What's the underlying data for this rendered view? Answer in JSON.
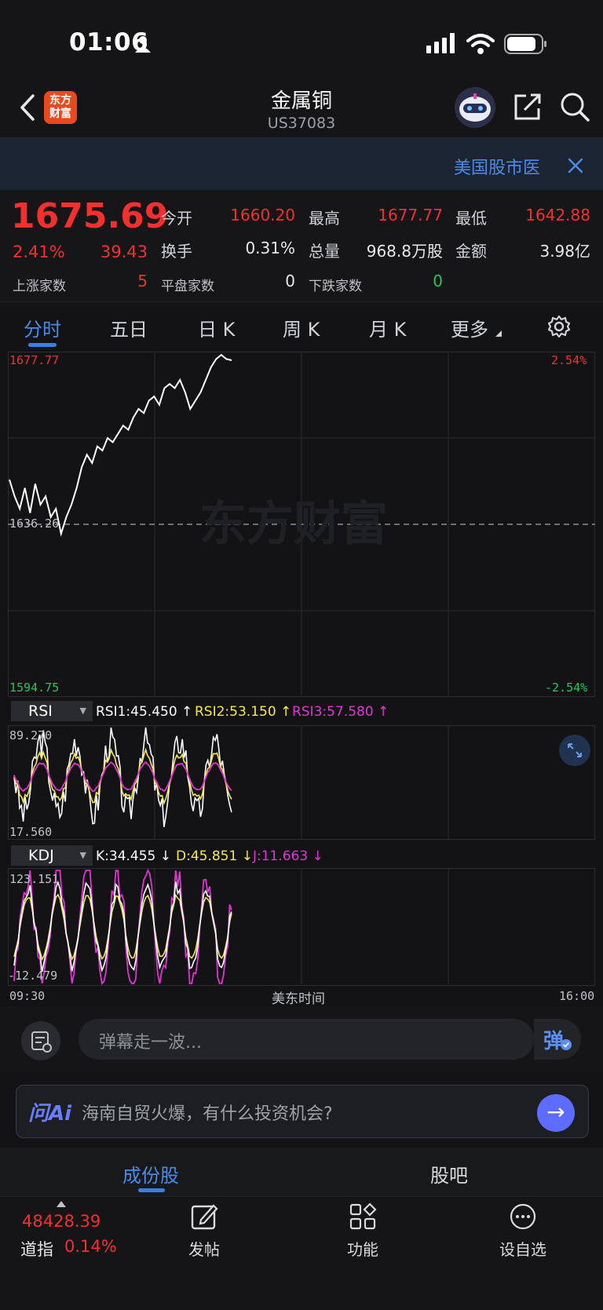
{
  "status": {
    "time": "01:06"
  },
  "header": {
    "title": "金属铜",
    "code": "US37083",
    "logo_line1": "东方",
    "logo_line2": "财富"
  },
  "banner": {
    "text": "美国股市医"
  },
  "quote": {
    "price": "1675.69",
    "change_pct": "2.41%",
    "change": "39.43",
    "open_label": "今开",
    "open": "1660.20",
    "high_label": "最高",
    "high": "1677.77",
    "low_label": "最低",
    "low": "1642.88",
    "turnover_label": "换手",
    "turnover": "0.31%",
    "volume_label": "总量",
    "volume": "968.8万股",
    "amount_label": "金额",
    "amount": "3.98亿",
    "up_label": "上涨家数",
    "up": "5",
    "flat_label": "平盘家数",
    "flat": "0",
    "down_label": "下跌家数",
    "down": "0"
  },
  "tabs": [
    {
      "label": "分时",
      "active": true
    },
    {
      "label": "五日"
    },
    {
      "label": "日 K"
    },
    {
      "label": "周 K"
    },
    {
      "label": "月 K"
    },
    {
      "label": "更多"
    }
  ],
  "chart": {
    "top_price": "1677.77",
    "mid_price": "1636.26",
    "bottom_price": "1594.75",
    "top_pct": "2.54%",
    "bottom_pct": "-2.54%",
    "watermark": "东方财富",
    "time_start": "09:30",
    "time_mid": "美东时间",
    "time_end": "16:00"
  },
  "rsi": {
    "name": "RSI",
    "rsi1": "RSI1:45.450 ↑",
    "rsi2": "RSI2:53.150 ↑",
    "rsi3": "RSI3:57.580 ↑",
    "max": "89.270",
    "min": "17.560"
  },
  "kdj": {
    "name": "KDJ",
    "k": "K:34.455 ↓",
    "d": "D:45.851 ↓",
    "j": "J:11.663 ↓",
    "max": "123.151",
    "min": "-12.479"
  },
  "chart_data": {
    "type": "line",
    "title": "",
    "x_range": [
      "09:30",
      "16:00"
    ],
    "ylim": [
      1594.75,
      1677.77
    ],
    "reference": 1636.26,
    "series": [
      {
        "values": [
          1647,
          1643,
          1640,
          1645,
          1639,
          1646,
          1641,
          1643,
          1638,
          1640,
          1634,
          1638,
          1641,
          1645,
          1650,
          1653,
          1651,
          1655,
          1654,
          1657,
          1656,
          1658,
          1660,
          1659,
          1662,
          1664,
          1663,
          1666,
          1667,
          1665,
          1669,
          1670,
          1669,
          1671,
          1668,
          1664,
          1666,
          1668,
          1671,
          1674,
          1676,
          1677,
          1676,
          1675.69
        ]
      }
    ]
  },
  "comment": {
    "placeholder": "弹幕走一波...",
    "button": "弹"
  },
  "ai": {
    "logo": "问Ai",
    "prompt": "海南自贸火爆，有什么投资机会?"
  },
  "bottom_tabs": [
    {
      "label": "成份股",
      "active": true
    },
    {
      "label": "股吧"
    }
  ],
  "toolbar": {
    "index_value": "48428.39",
    "index_name": "道指",
    "index_pct": "0.14%",
    "post": "发帖",
    "function": "功能",
    "watch": "设自选"
  },
  "colors": {
    "up": "#f23030",
    "down": "#22c55e",
    "accent": "#4d8ae6",
    "rsi2": "#f5e94a",
    "rsi3": "#e233d6"
  }
}
